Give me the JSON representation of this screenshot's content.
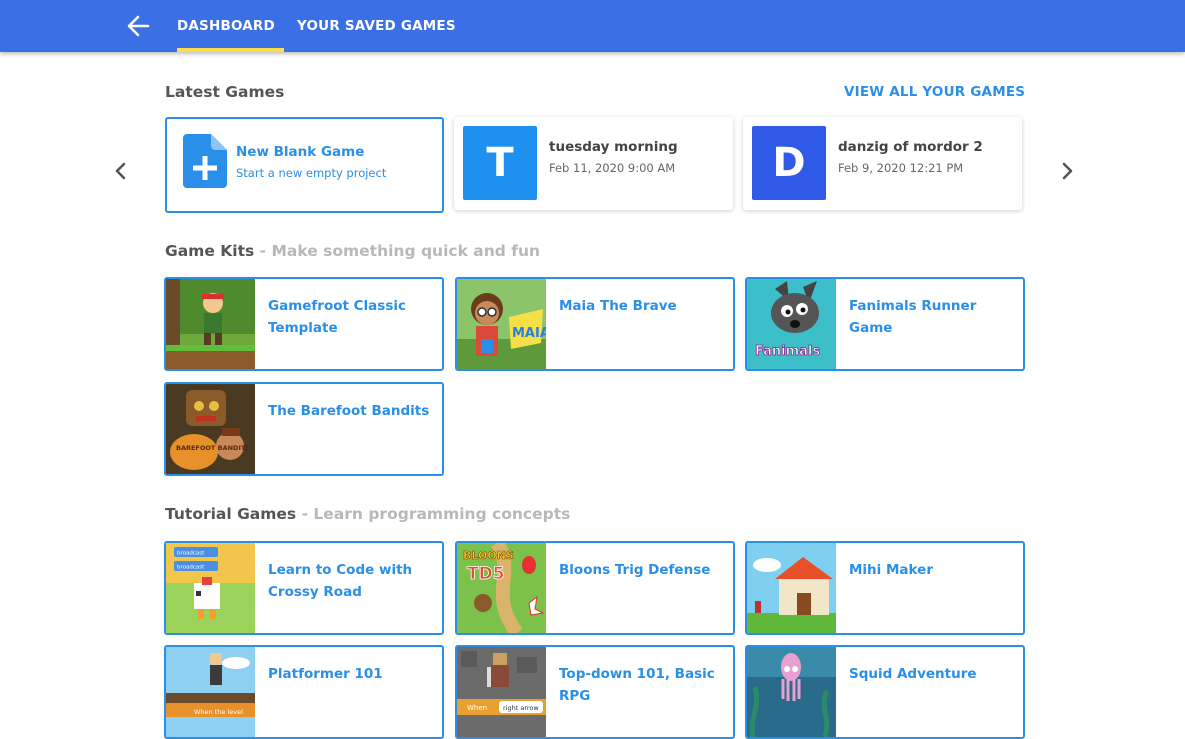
{
  "header": {
    "tabs": [
      {
        "label": "DASHBOARD",
        "active": true
      },
      {
        "label": "YOUR SAVED GAMES",
        "active": false
      }
    ],
    "accent": "#3b6fe6",
    "tab_indicator_color": "#ffdc4a"
  },
  "latest": {
    "title": "Latest Games",
    "view_all": "VIEW ALL YOUR GAMES",
    "new_game": {
      "title": "New Blank Game",
      "subtitle": "Start a new empty project",
      "icon": "new-file-icon"
    },
    "games": [
      {
        "letter": "T",
        "title": "tuesday morning",
        "date": "Feb 11, 2020 9:00 AM",
        "color": "#1e90f0"
      },
      {
        "letter": "D",
        "title": "danzig of mordor 2",
        "date": "Feb 9, 2020 12:21 PM",
        "color": "#2f5ae8"
      }
    ]
  },
  "game_kits": {
    "title": "Game Kits",
    "dash": " - ",
    "subtitle": "Make something quick and fun",
    "items": [
      {
        "label": "Gamefroot Classic Template"
      },
      {
        "label": "Maia The Brave"
      },
      {
        "label": "Fanimals Runner Game"
      },
      {
        "label": "The Barefoot Bandits"
      }
    ]
  },
  "tutorials": {
    "title": "Tutorial Games",
    "dash": " - ",
    "subtitle": "Learn programming concepts",
    "items": [
      {
        "label": "Learn to Code with Crossy Road"
      },
      {
        "label": "Bloons Trig Defense"
      },
      {
        "label": "Mihi Maker"
      },
      {
        "label": "Platformer 101"
      },
      {
        "label": "Top-down 101, Basic RPG"
      },
      {
        "label": "Squid Adventure"
      }
    ],
    "thumb_texts": {
      "crossy_a": "broadcast",
      "crossy_b": "broadcast",
      "bloons_logo_top": "BLOONS",
      "bloons_logo_bottom": "TD5",
      "platformer_caption": "When the level",
      "topdown_when": "When",
      "topdown_key": "right arrow"
    }
  },
  "thumb_texts": {
    "maia": "MAIA",
    "fanimals": "Fanimals",
    "barefoot": "BAREFOOT BANDITS"
  },
  "colors": {
    "link": "#2a8fe8",
    "section_title": "#555555",
    "section_subtitle": "#b8b8b8"
  }
}
